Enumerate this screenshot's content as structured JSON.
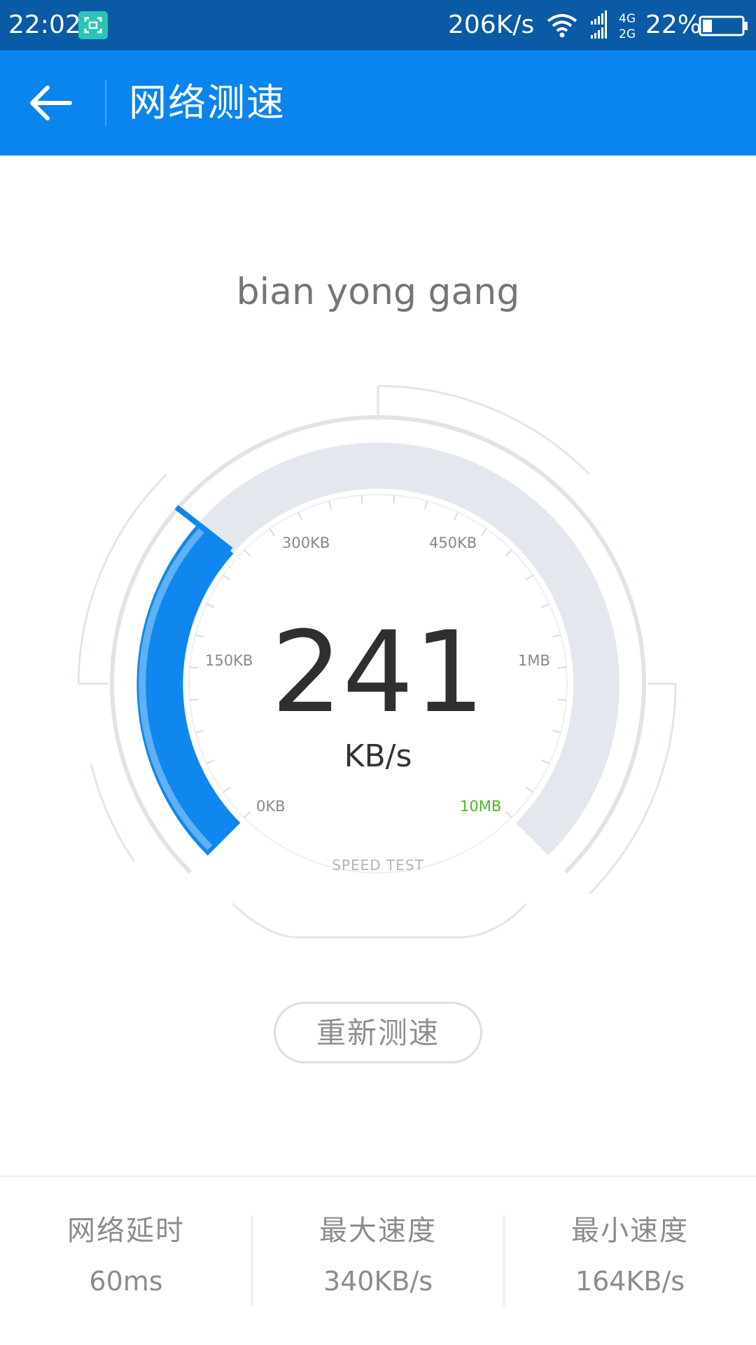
{
  "status_bar": {
    "time": "22:02",
    "net_speed": "206K/s",
    "battery": "22%",
    "signal_labels": [
      "4G",
      "2G"
    ],
    "icons": [
      "screenshot-icon",
      "wifi-icon",
      "signal-icon",
      "battery-icon"
    ]
  },
  "header": {
    "title": "网络测速",
    "back_icon": "arrow-left-icon"
  },
  "network_name": "bian yong gang",
  "gauge": {
    "speed": "241",
    "unit": "KB/s",
    "caption": "SPEED TEST",
    "tick_labels": {
      "0kb": "0KB",
      "150kb": "150KB",
      "300kb": "300KB",
      "450kb": "450KB",
      "1mb": "1MB",
      "10mb": "10MB"
    },
    "progress_fraction": 0.27
  },
  "retest_button": "重新测速",
  "stats": [
    {
      "label": "网络延时",
      "value": "60ms"
    },
    {
      "label": "最大速度",
      "value": "340KB/s"
    },
    {
      "label": "最小速度",
      "value": "164KB/s"
    }
  ],
  "colors": {
    "status_bar": "#0a5aa6",
    "app_bar": "#0a84ee",
    "gauge_fill": "#0f87ee",
    "gauge_track": "#e4e8ee",
    "max_label": "#4cb81a"
  }
}
